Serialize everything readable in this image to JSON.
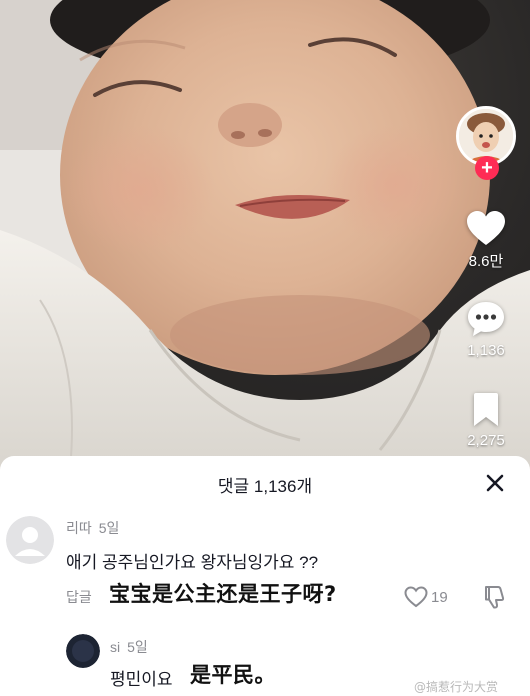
{
  "video": {
    "likes": "8.6만",
    "comments": "1,136",
    "saves": "2,275"
  },
  "sheet": {
    "title": "댓글 1,136개"
  },
  "comments": [
    {
      "username": "리따",
      "age": "5일",
      "text": "애기 공주님인가요 왕자님잉가요 ??",
      "reply_label": "답글",
      "translation_overlay": "宝宝是公主还是王子呀?",
      "like_count": "19"
    },
    {
      "username": "si",
      "age": "5일",
      "text": "평민이요",
      "translation_overlay": "是平民。"
    }
  ],
  "watermark": "@搞惹行为大赏",
  "colors": {
    "accent_red": "#fe2c55",
    "text_primary": "#161823",
    "text_secondary": "#8a8b91"
  },
  "icons": {
    "like": "heart-icon",
    "comment": "speech-bubble-icon",
    "save": "bookmark-icon",
    "close": "close-icon",
    "comment_like": "heart-outline-icon",
    "comment_dislike": "thumbs-down-icon",
    "follow": "plus-icon"
  }
}
